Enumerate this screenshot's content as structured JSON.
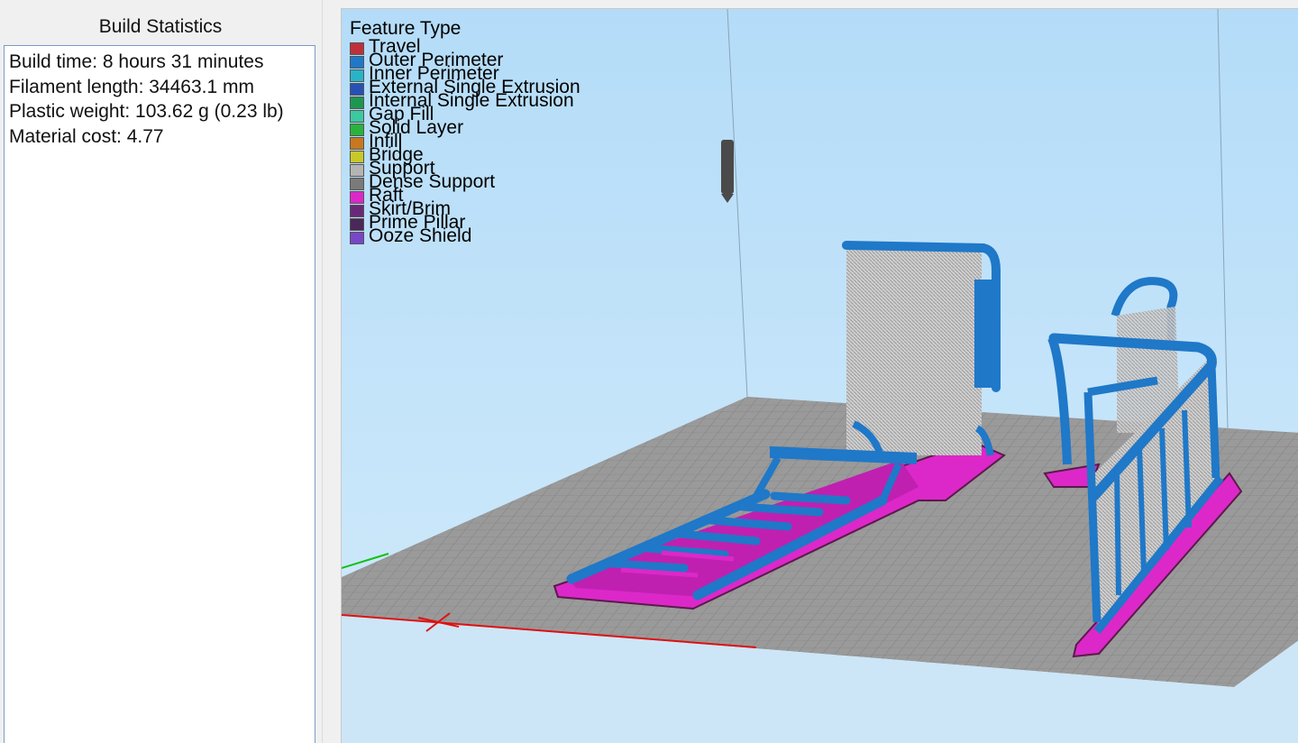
{
  "panel": {
    "title": "Build Statistics",
    "stats": [
      "Build time: 8 hours 31 minutes",
      "Filament length: 34463.1 mm",
      "Plastic weight: 103.62 g (0.23 lb)",
      "Material cost: 4.77"
    ]
  },
  "legend": {
    "title": "Feature Type",
    "items": [
      {
        "label": "Travel",
        "color": "#c0303a"
      },
      {
        "label": "Outer Perimeter",
        "color": "#1f78c8"
      },
      {
        "label": "Inner Perimeter",
        "color": "#28b4c8"
      },
      {
        "label": "External Single Extrusion",
        "color": "#2850b4"
      },
      {
        "label": "Internal Single Extrusion",
        "color": "#1e9650"
      },
      {
        "label": "Gap Fill",
        "color": "#3cc8a0"
      },
      {
        "label": "Solid Layer",
        "color": "#28b43c"
      },
      {
        "label": "Infill",
        "color": "#c8781e"
      },
      {
        "label": "Bridge",
        "color": "#c8c828"
      },
      {
        "label": "Support",
        "color": "#b4b4b4"
      },
      {
        "label": "Dense Support",
        "color": "#7a7a7a"
      },
      {
        "label": "Raft",
        "color": "#dc28c8"
      },
      {
        "label": "Skirt/Brim",
        "color": "#6a2878"
      },
      {
        "label": "Prime Pillar",
        "color": "#4a285a"
      },
      {
        "label": "Ooze Shield",
        "color": "#7846c8"
      }
    ]
  },
  "colors": {
    "sky_top": "#b4dcf8",
    "sky_bottom": "#cfe9fb",
    "bed": "#9a9a9a",
    "grid": "#7d7d7d",
    "x_axis": "#e01010",
    "y_axis": "#10c010",
    "perimeter": "#1f78c8",
    "raft": "#dc28c8",
    "support": "#c8c8c8"
  }
}
